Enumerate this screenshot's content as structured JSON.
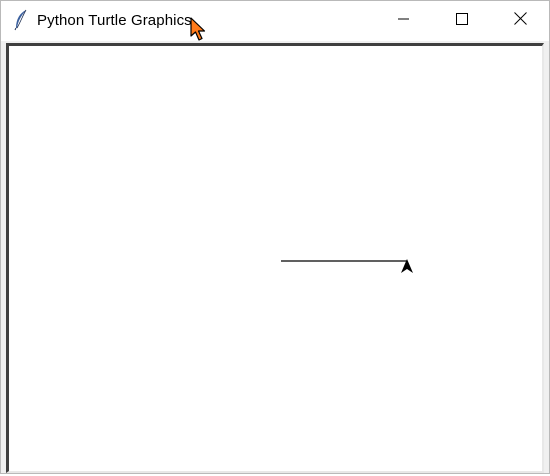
{
  "window": {
    "title": "Python Turtle Graphics",
    "app_icon": "feather-icon",
    "controls": {
      "minimize_icon": "minimize-icon",
      "maximize_icon": "maximize-icon",
      "close_icon": "close-icon"
    }
  },
  "canvas": {
    "background": "#ffffff",
    "line_color": "#000000",
    "turtle_shape": "arrow",
    "turtle_heading": "up"
  },
  "cursor": {
    "icon": "mouse-pointer-icon",
    "color": "#ff7a1a"
  }
}
